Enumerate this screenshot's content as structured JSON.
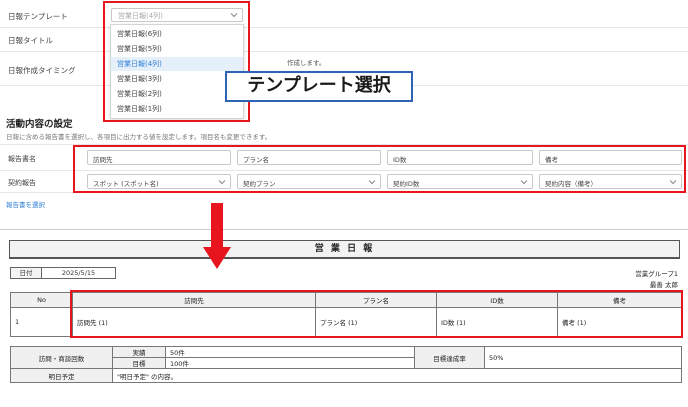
{
  "form": {
    "template_label": "日報テンプレート",
    "title_label": "日報タイトル",
    "timing_label": "日報作成タイミング",
    "timing_desc": "作成します。",
    "template_select": {
      "value": "営業日報(4列)",
      "options": [
        "営業日報(6列)",
        "営業日報(5列)",
        "営業日報(4列)",
        "営業日報(3列)",
        "営業日報(2列)",
        "営業日報(1列)"
      ]
    }
  },
  "callout": "テンプレート選択",
  "activity": {
    "title": "活動内容の設定",
    "description": "日報に含める報告書を選択し、各項目に出力する値を設定します。項目名も変更できます。",
    "report_name_label": "報告書名",
    "contract_label": "契約報告",
    "report_names": [
      "訪問先",
      "プラン名",
      "ID数",
      "備考"
    ],
    "contract_values": [
      "スポット (スポット名)",
      "契約プラン",
      "契約ID数",
      "契約内容（備考）"
    ],
    "select_link": "報告書を選択"
  },
  "report": {
    "title": "営 業 日 報",
    "date_label": "日付",
    "date_value": "2025/5/15",
    "group": "営業グループ1",
    "person": "最善 太郎",
    "columns": [
      "No",
      "訪問先",
      "プラン名",
      "ID数",
      "備考"
    ],
    "rows": [
      [
        "1",
        "訪問先 (1)",
        "プラン名 (1)",
        "ID数 (1)",
        "備考 (1)"
      ]
    ],
    "stats": {
      "visits_label": "訪問・商談回数",
      "actual_label": "実績",
      "actual_value": "50件",
      "target_label": "目標",
      "target_value": "100件",
      "rate_label": "目標達成率",
      "rate_value": "50%",
      "plan_label": "明日予定",
      "plan_value": "\"明日予定\" の内容。"
    }
  },
  "colors": {
    "highlight": "#e8141e",
    "callout_border": "#2f64b5",
    "link": "#2f7fd6",
    "selected_option": "#e6f0fb"
  }
}
